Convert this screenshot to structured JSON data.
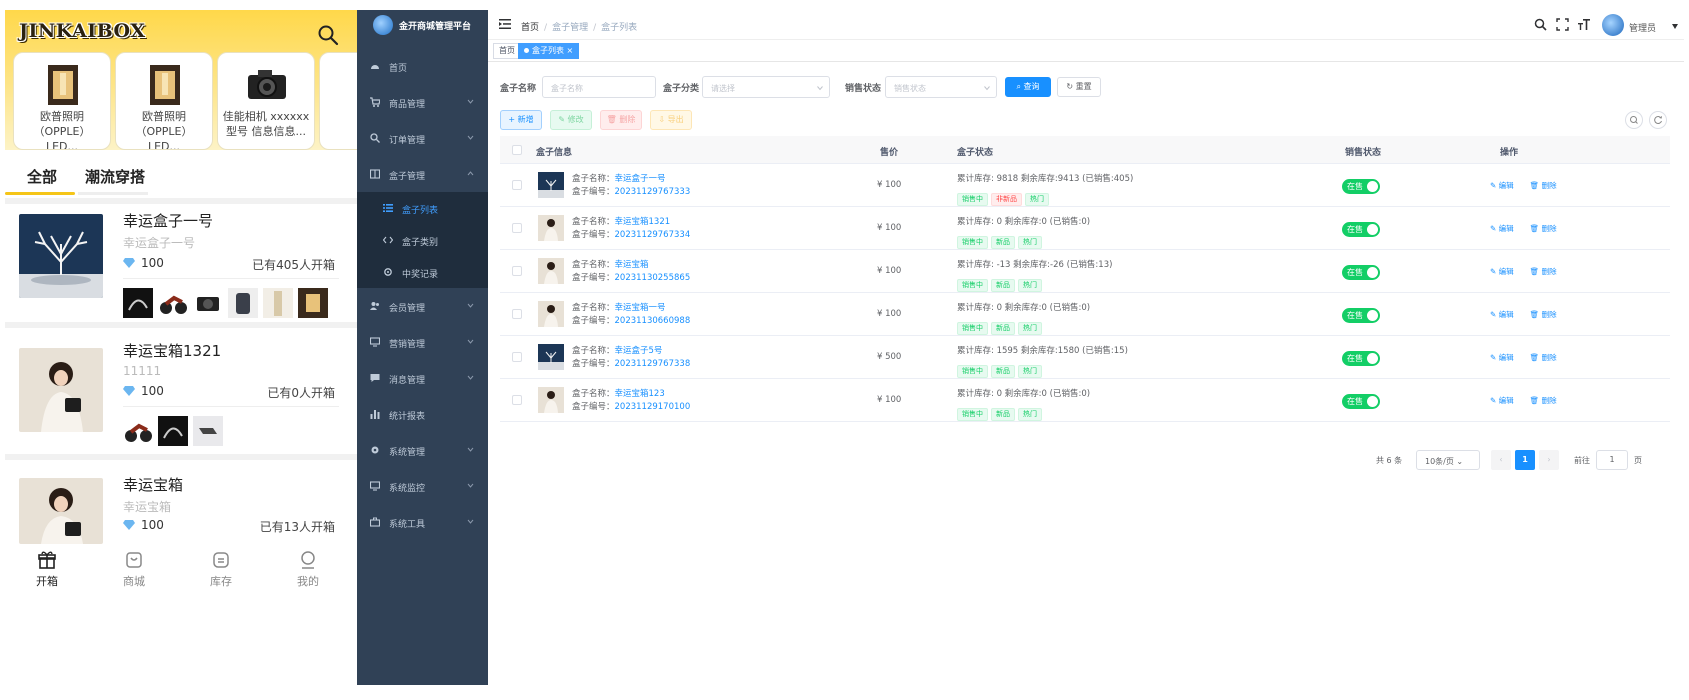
{
  "mobile": {
    "logo": "JINKAIBOX",
    "featured": [
      {
        "title": "欧普照明（OPPLE）LED..."
      },
      {
        "title": "欧普照明（OPPLE）LED..."
      },
      {
        "title": "佳能相机 xxxxxx 型号 信息信息..."
      }
    ],
    "tabs": [
      "全部",
      "潮流穿搭"
    ],
    "boxes": [
      {
        "name": "幸运盒子一号",
        "sub": "幸运盒子一号",
        "price": "100",
        "opened": "已有405人开箱"
      },
      {
        "name": "幸运宝箱1321",
        "sub": "11111",
        "price": "100",
        "opened": "已有0人开箱"
      },
      {
        "name": "幸运宝箱",
        "sub": "幸运宝箱",
        "price": "100",
        "opened": "已有13人开箱"
      }
    ],
    "bottom_nav": [
      "开箱",
      "商城",
      "库存",
      "我的"
    ]
  },
  "admin": {
    "brand": "金开商城管理平台",
    "menu": {
      "home": "首页",
      "goods": "商品管理",
      "orders": "订单管理",
      "boxes": "盒子管理",
      "box_list": "盒子列表",
      "box_category": "盒子类别",
      "win_records": "中奖记录",
      "members": "会员管理",
      "marketing": "营销管理",
      "messages": "消息管理",
      "stats": "统计报表",
      "system": "系统管理",
      "monitor": "系统监控",
      "tools": "系统工具"
    },
    "breadcrumb": [
      "首页",
      "盒子管理",
      "盒子列表"
    ],
    "user": "管理员",
    "tags": [
      "首页",
      "盒子列表"
    ],
    "search": {
      "name_label": "盒子名称",
      "name_placeholder": "盒子名称",
      "category_label": "盒子分类",
      "category_placeholder": "请选择",
      "status_label": "销售状态",
      "status_placeholder": "销售状态",
      "query": "查询",
      "reset": "重置"
    },
    "toolbar": {
      "add": "新增",
      "edit": "修改",
      "delete": "删除",
      "export": "导出"
    },
    "columns": [
      "盒子信息",
      "售价",
      "盒子状态",
      "销售状态",
      "操作"
    ],
    "name_prefix": "盒子名称：",
    "code_prefix": "盒子编号：",
    "rows": [
      {
        "name": "幸运盒子一号",
        "code": "20231129767333",
        "price": "¥ 100",
        "stock": "累计库存: 9818 剩余库存:9413 (已销售:405)",
        "tags": [
          "销售中",
          "非新品",
          "热门"
        ],
        "status": "在售"
      },
      {
        "name": "幸运宝箱1321",
        "code": "20231129767334",
        "price": "¥ 100",
        "stock": "累计库存: 0 剩余库存:0 (已销售:0)",
        "tags": [
          "销售中",
          "新品",
          "热门"
        ],
        "status": "在售"
      },
      {
        "name": "幸运宝箱",
        "code": "20231130255865",
        "price": "¥ 100",
        "stock": "累计库存: -13 剩余库存:-26 (已销售:13)",
        "tags": [
          "销售中",
          "新品",
          "热门"
        ],
        "status": "在售"
      },
      {
        "name": "幸运宝箱一号",
        "code": "20231130660988",
        "price": "¥ 100",
        "stock": "累计库存: 0 剩余库存:0 (已销售:0)",
        "tags": [
          "销售中",
          "新品",
          "热门"
        ],
        "status": "在售"
      },
      {
        "name": "幸运盒子5号",
        "code": "20231129767338",
        "price": "¥ 500",
        "stock": "累计库存: 1595 剩余库存:1580 (已销售:15)",
        "tags": [
          "销售中",
          "新品",
          "热门"
        ],
        "status": "在售"
      },
      {
        "name": "幸运宝箱123",
        "code": "20231129170100",
        "price": "¥ 100",
        "stock": "累计库存: 0 剩余库存:0 (已销售:0)",
        "tags": [
          "销售中",
          "新品",
          "热门"
        ],
        "status": "在售"
      }
    ],
    "row_actions": {
      "edit": "编辑",
      "delete": "删除"
    },
    "pagination": {
      "total": "共 6 条",
      "page_size": "10条/页",
      "current": "1",
      "goto": "前往",
      "goto_value": "1",
      "page_unit": "页"
    }
  },
  "colors": {
    "accent": "#1890ff",
    "sidebar": "#304156",
    "success": "#13ce66",
    "mobile_header": "#ffd84a"
  }
}
